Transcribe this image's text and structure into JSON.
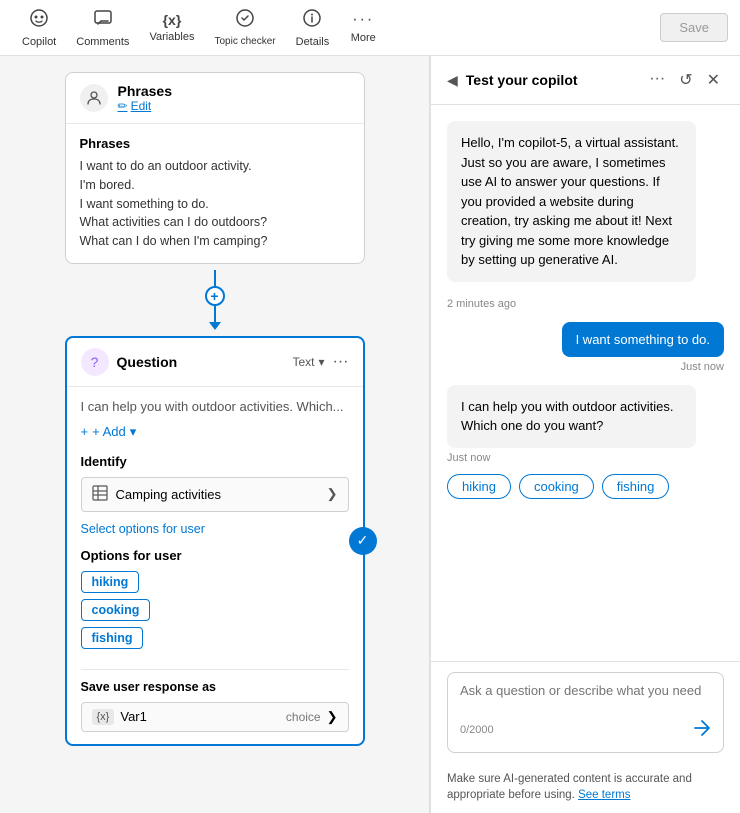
{
  "toolbar": {
    "items": [
      {
        "id": "copilot",
        "label": "Copilot",
        "icon": "🤖"
      },
      {
        "id": "comments",
        "label": "Comments",
        "icon": "💬"
      },
      {
        "id": "variables",
        "label": "Variables",
        "icon": "{x}"
      },
      {
        "id": "topic-checker",
        "label": "Topic checker",
        "icon": "✓"
      },
      {
        "id": "details",
        "label": "Details",
        "icon": "ℹ"
      },
      {
        "id": "more",
        "label": "More",
        "icon": "···"
      }
    ],
    "save_label": "Save"
  },
  "phrases_card": {
    "title": "Phrases",
    "edit_label": "Edit",
    "body_title": "Phrases",
    "phrases": [
      "I want to do an outdoor activity.",
      "I'm bored.",
      "I want something to do.",
      "What activities can I do outdoors?",
      "What can I do when I'm camping?"
    ]
  },
  "question_card": {
    "title": "Question",
    "type": "Text",
    "preview": "I can help you with outdoor activities. Which...",
    "add_label": "+ Add",
    "identify_label": "Identify",
    "identify_value": "Camping activities",
    "select_options_label": "Select options for user",
    "options_label": "Options for user",
    "options": [
      "hiking",
      "cooking",
      "fishing"
    ],
    "save_response_label": "Save user response as",
    "var_badge": "{x}",
    "var_name": "Var1",
    "var_type": "choice"
  },
  "copilot_panel": {
    "header_chevron": "◀",
    "title": "Test your copilot",
    "menu_icon": "···",
    "refresh_icon": "↺",
    "close_icon": "✕",
    "bot_message_1": "Hello, I'm copilot-5, a virtual assistant. Just so you are aware, I sometimes use AI to answer your questions. If you provided a website during creation, try asking me about it! Next try giving me some more knowledge by setting up generative AI.",
    "bot_message_1_time": "2 minutes ago",
    "user_message": "I want something to do.",
    "user_message_time": "Just now",
    "bot_message_2": "I can help you with outdoor activities. Which one do you want?",
    "bot_message_2_time": "Just now",
    "option_chips": [
      "hiking",
      "cooking",
      "fishing"
    ],
    "input_placeholder": "Ask a question or describe what you need",
    "char_count": "0/2000",
    "disclaimer": "Make sure AI-generated content is accurate and appropriate before using.",
    "see_terms_label": "See terms"
  }
}
